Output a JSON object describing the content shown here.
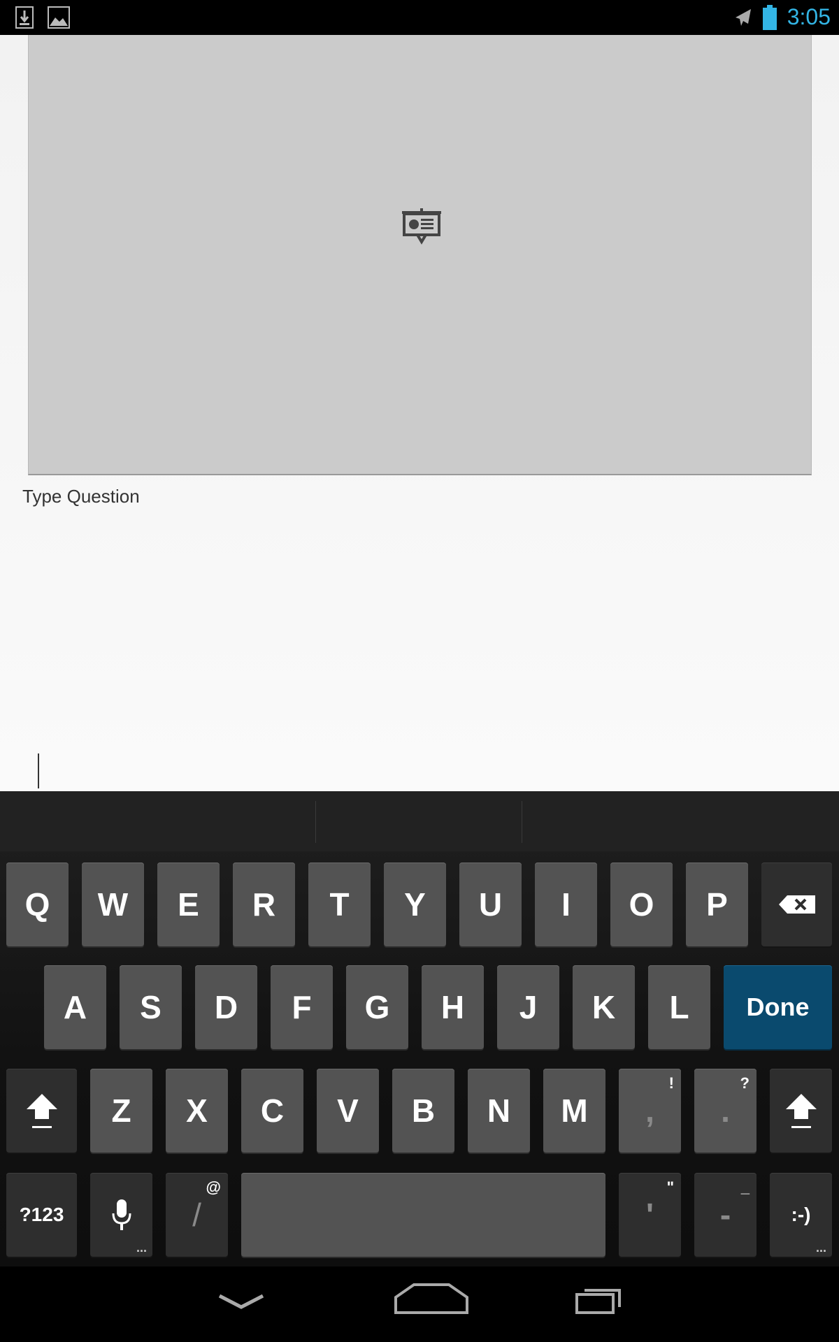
{
  "status_bar": {
    "time": "3:05",
    "icons": [
      "download-icon",
      "image-icon",
      "airplane-mode-icon",
      "battery-icon"
    ],
    "accent_color": "#33b5e5"
  },
  "slide": {
    "icon": "presentation-icon"
  },
  "question": {
    "label": "Type Question",
    "value": ""
  },
  "keyboard": {
    "row1": [
      "Q",
      "W",
      "E",
      "R",
      "T",
      "Y",
      "U",
      "I",
      "O",
      "P"
    ],
    "row2": [
      "A",
      "S",
      "D",
      "F",
      "G",
      "H",
      "J",
      "K",
      "L"
    ],
    "done_label": "Done",
    "row3": [
      "Z",
      "X",
      "C",
      "V",
      "B",
      "N",
      "M"
    ],
    "comma": ",",
    "comma_hint": "!",
    "period": ".",
    "period_hint": "?",
    "symbols_label": "?123",
    "slash": "/",
    "slash_hint": "@",
    "apostrophe": "'",
    "apostrophe_hint": "\"",
    "dash": "-",
    "dash_hint": "_",
    "smiley": ":-)",
    "more_dots": "...",
    "done_color": "#0a4a6e"
  },
  "nav_bar": {
    "icons": [
      "back-icon",
      "home-icon",
      "recent-apps-icon"
    ]
  }
}
